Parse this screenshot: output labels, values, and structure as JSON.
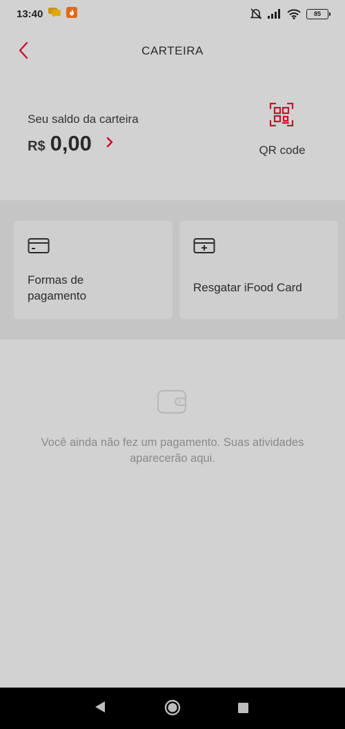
{
  "status_bar": {
    "time": "13:40",
    "battery": "85",
    "icons": [
      "chat-notification-icon",
      "app-notification-icon",
      "mute-icon",
      "signal-icon",
      "wifi-icon",
      "battery-icon"
    ]
  },
  "header": {
    "title": "CARTEIRA",
    "back_icon": "chevron-left-icon"
  },
  "balance": {
    "label": "Seu saldo da carteira",
    "currency": "R$",
    "amount": "0,00"
  },
  "qr": {
    "label": "QR code",
    "icon": "qr-code-icon"
  },
  "cards": [
    {
      "label": "Formas de pagamento",
      "icon": "credit-card-icon"
    },
    {
      "label": "Resgatar iFood Card",
      "icon": "card-add-icon"
    }
  ],
  "empty_state": {
    "icon": "wallet-icon",
    "message": "Você ainda não fez um pagamento. Suas atividades aparecerão aqui."
  },
  "colors": {
    "background": "#d2d2d2",
    "accent": "#c8102e",
    "band": "#c5c5c5",
    "card": "#cfcfcf",
    "nav_bar": "#000000"
  }
}
